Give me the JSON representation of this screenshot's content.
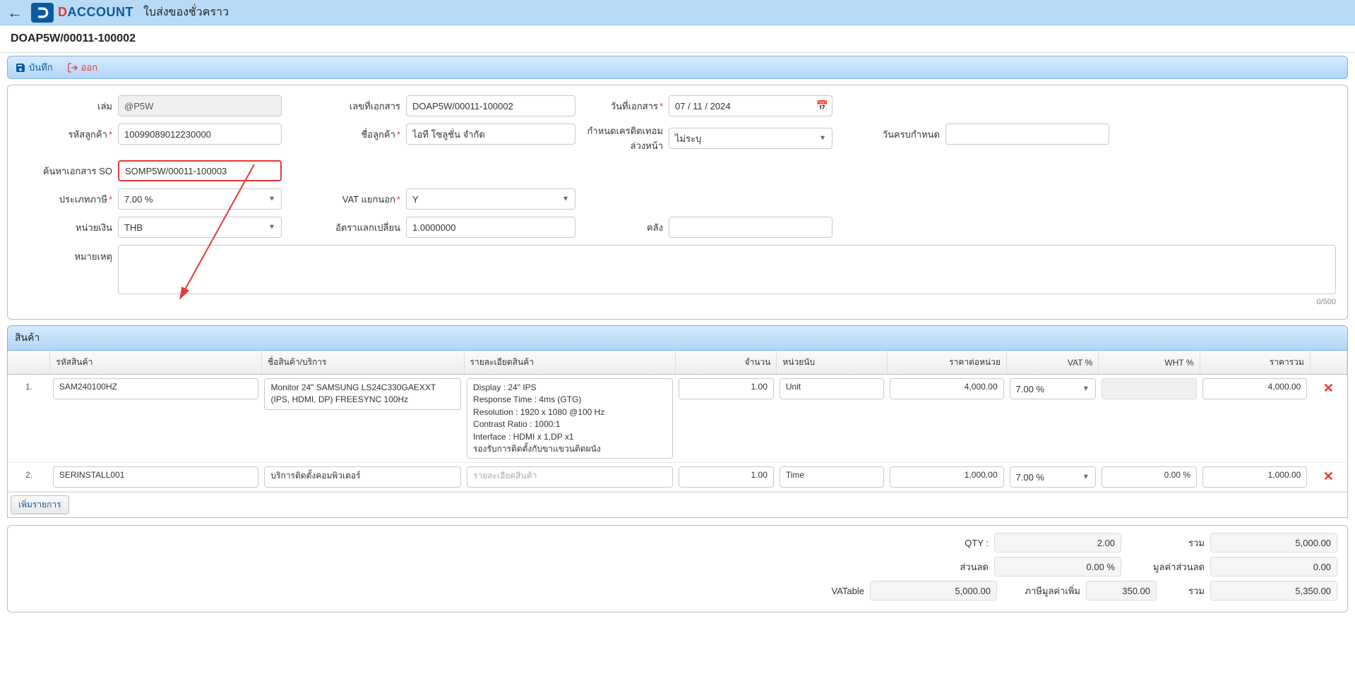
{
  "header": {
    "page_title_top": "ใบส่งของชั่วคราว",
    "doc_number_title": "DOAP5W/00011-100002",
    "brand_d": "D",
    "brand_rest": "ACCOUNT"
  },
  "toolbar": {
    "save": "บันทึก",
    "exit": "ออก"
  },
  "form": {
    "labels": {
      "volume": "เล่ม",
      "doc_no": "เลขที่เอกสาร",
      "doc_date": "วันที่เอกสาร",
      "cust_code": "รหัสลูกค้า",
      "cust_name": "ชื่อลูกค้า",
      "credit_limit": "กำหนดเครดิตเทอมล่วงหน้า",
      "due_date": "วันครบกำหนด",
      "search_so": "ค้นหาเอกสาร SO",
      "tax_type": "ประเภทภาษี",
      "vat_sep": "VAT แยกนอก",
      "currency": "หน่วยเงิน",
      "exch_rate": "อัตราแลกเปลี่ยน",
      "warehouse": "คลัง",
      "remark": "หมายเหตุ"
    },
    "values": {
      "volume": "@P5W",
      "doc_no": "DOAP5W/00011-100002",
      "doc_date": "07 / 11 / 2024",
      "cust_code": "10099089012230000",
      "cust_name": "ไอที โซลูชั่น จำกัด",
      "credit_limit": "ไม่ระบุ",
      "due_date": "",
      "search_so": "SOMP5W/00011-100003",
      "tax_type": "7.00 %",
      "vat_sep": "Y",
      "currency": "THB",
      "exch_rate": "1.0000000",
      "warehouse": "",
      "remark": "",
      "char_count": "0/500"
    }
  },
  "grid": {
    "section_title": "สินค้า",
    "headers": {
      "code": "รหัสสินค้า",
      "name": "ชื่อสินค้า/บริการ",
      "detail": "รายละเอียดสินค้า",
      "qty": "จำนวน",
      "unit": "หน่วยนับ",
      "price": "ราคาต่อหน่วย",
      "vat": "VAT %",
      "wht": "WHT %",
      "total": "ราคารวม"
    },
    "detail_placeholder": "รายละเอียดสินค้า",
    "rows": [
      {
        "n": "1.",
        "code": "SAM240100HZ",
        "name": "Monitor 24\" SAMSUNG LS24C330GAEXXT (IPS, HDMI, DP) FREESYNC 100Hz",
        "detail": "Display : 24\" IPS\nResponse Time : 4ms (GTG)\nResolution : 1920 x 1080 @100 Hz\nContrast Ratio : 1000:1\nInterface : HDMI x 1,DP x1\nรองรับการติดตั้งกับขาแขวนติดผนัง",
        "qty": "1.00",
        "unit": "Unit",
        "price": "4,000.00",
        "vat": "7.00 %",
        "wht": "",
        "total": "4,000.00",
        "wht_disabled": true
      },
      {
        "n": "2.",
        "code": "SERINSTALL001",
        "name": "บริการติดตั้งคอมพิวเตอร์",
        "detail": "",
        "qty": "1.00",
        "unit": "Time",
        "price": "1,000.00",
        "vat": "7.00 %",
        "wht": "0.00 %",
        "total": "1,000.00",
        "wht_disabled": false
      }
    ],
    "add_row": "เพิ่มรายการ"
  },
  "totals": {
    "labels": {
      "qty": "QTY :",
      "sum": "รวม",
      "discount": "ส่วนลด",
      "discount_amt": "มูลค่าส่วนลด",
      "vatable": "VATable",
      "vat_add": "ภาษีมูลค่าเพิ่ม",
      "grand": "รวม"
    },
    "values": {
      "qty": "2.00",
      "sum": "5,000.00",
      "discount": "0.00 %",
      "discount_amt": "0.00",
      "vatable": "5,000.00",
      "vat_add": "350.00",
      "grand": "5,350.00"
    }
  }
}
